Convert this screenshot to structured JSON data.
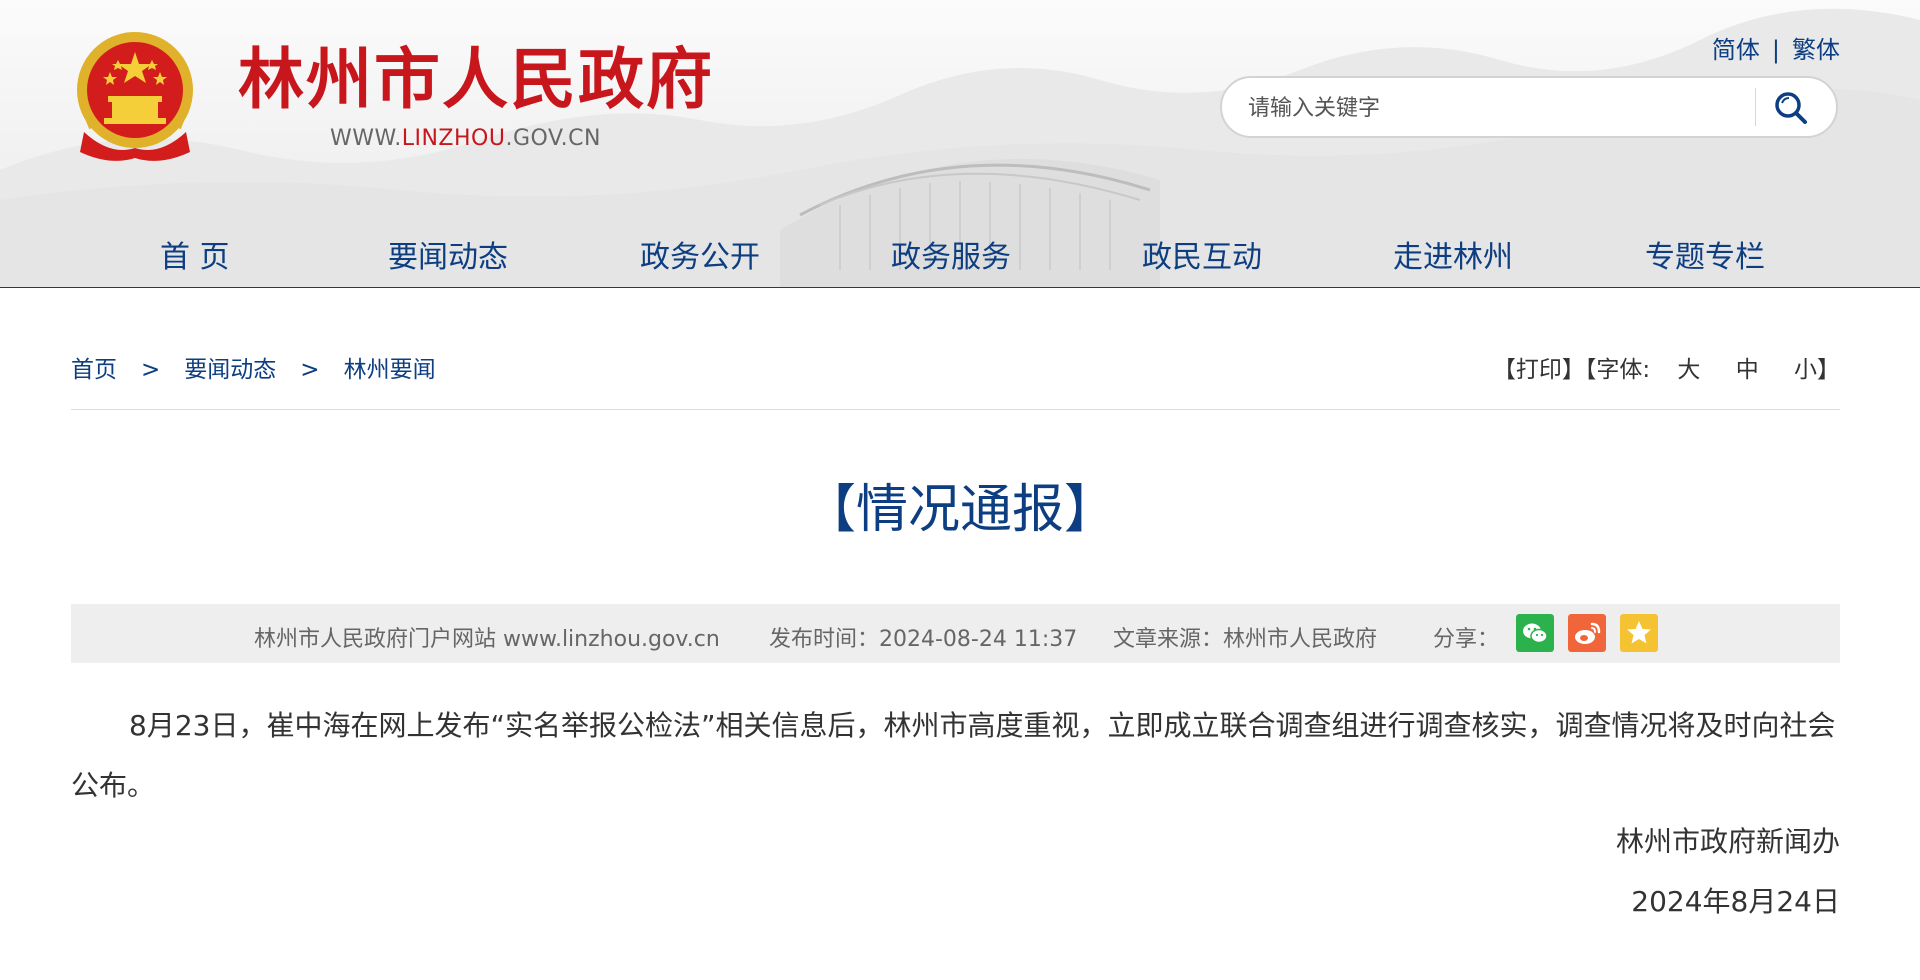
{
  "header": {
    "site_name": "林州市人民政府",
    "site_url": {
      "pre": "WWW.",
      "highlight": "LINZHOU",
      "post": ".GOV.CN"
    },
    "lang": {
      "simplified": "简体",
      "separator": "|",
      "traditional": "繁体"
    },
    "search": {
      "placeholder": "请输入关键字",
      "icon": "search-icon"
    },
    "brand_color": "#c8161d",
    "accent_color": "#0d3e82"
  },
  "nav": {
    "items": [
      "首  页",
      "要闻动态",
      "政务公开",
      "政务服务",
      "政民互动",
      "走进林州",
      "专题专栏"
    ]
  },
  "breadcrumb": {
    "items": [
      "首页",
      "要闻动态",
      "林州要闻"
    ],
    "separator": ">"
  },
  "tools": {
    "print": "【打印】",
    "font_label": "【字体:",
    "font_large": "大",
    "font_medium": "中",
    "font_small": "小】"
  },
  "article": {
    "title": "【情况通报】",
    "meta": {
      "source_site": "林州市人民政府门户网站 www.linzhou.gov.cn",
      "publish_time": "发布时间：2024-08-24 11:37",
      "article_source": "文章来源：林州市人民政府",
      "share_label": "分享：",
      "share_icons": [
        "wechat-icon",
        "weibo-icon",
        "favorite-icon"
      ]
    },
    "body": "8月23日，崔中海在网上发布“实名举报公检法”相关信息后，林州市高度重视，立即成立联合调查组进行调查核实，调查情况将及时向社会公布。",
    "signature": "林州市政府新闻办",
    "date": "2024年8月24日"
  }
}
